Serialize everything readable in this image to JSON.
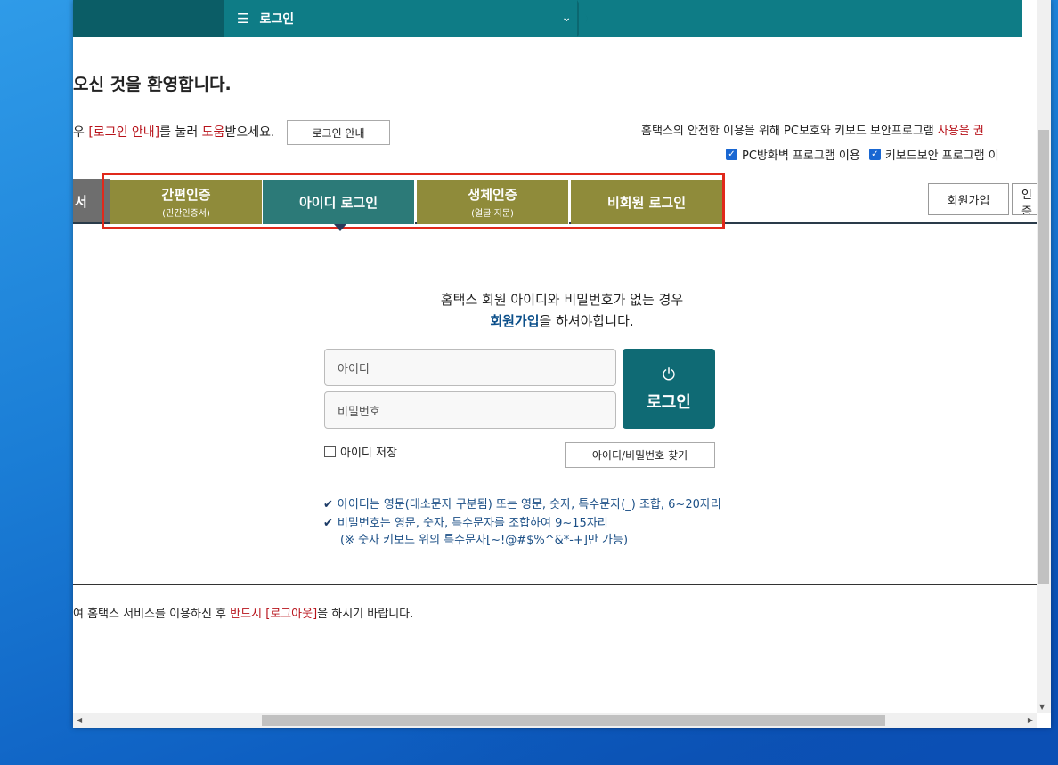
{
  "topbar": {
    "menu_icon": "☰",
    "menu_label": "로그인",
    "chevron": "⌄"
  },
  "welcome": "오신 것을 환영합니다.",
  "guide": {
    "prefix": "우 ",
    "link": "[로그인 안내]",
    "mid": "를 눌러 ",
    "help": "도움",
    "suffix": "받으세요.",
    "button": "로그인 안내"
  },
  "security": {
    "text": "홈택스의 안전한 이용을 위해 PC보호와 키보드 보안프로그램 ",
    "highlight": "사용을 권"
  },
  "checks": {
    "firewall": "PC방화벽 프로그램 이용",
    "keyboard": "키보드보안 프로그램 이"
  },
  "tabs": {
    "left_stub": "서",
    "items": [
      {
        "label": "간편인증",
        "sub": "(민간인증서)"
      },
      {
        "label": "아이디 로그인",
        "sub": ""
      },
      {
        "label": "생체인증",
        "sub": "(얼굴·지문)"
      },
      {
        "label": "비회원 로그인",
        "sub": ""
      }
    ],
    "signup": "회원가입",
    "more": "인증"
  },
  "notice": {
    "line1": "홈택스 회원 아이디와 비밀번호가 없는 경우",
    "signup_link": "회원가입",
    "line2_rest": "을 하셔야합니다."
  },
  "form": {
    "id_placeholder": "아이디",
    "pw_placeholder": "비밀번호",
    "login_icon": "⏻",
    "login_label": "로그인",
    "save_id": "아이디 저장",
    "find_button": "아이디/비밀번호 찾기"
  },
  "rules": {
    "tick": "✔",
    "id_rule": "아이디는 영문(대소문자 구분됨) 또는 영문, 숫자, 특수문자(_) 조합, 6~20자리",
    "pw_rule": "비밀번호는 영문, 숫자, 특수문자를 조합하여 9~15자리",
    "pw_note": "(※ 숫자 키보드 위의 특수문자[~!@#$%^&*-+]만 가능)"
  },
  "logout_note": {
    "prefix": "여 홈택스 서비스를 이용하신 후 ",
    "must": "반드시",
    "space": " ",
    "logout": "[로그아웃]",
    "suffix": "을 하시기 바랍니다."
  },
  "colors": {
    "teal": "#0e7c86",
    "olive_tab": "#8f8b3a",
    "active_tab": "#2c7a78",
    "highlight_red": "#e0291b"
  }
}
